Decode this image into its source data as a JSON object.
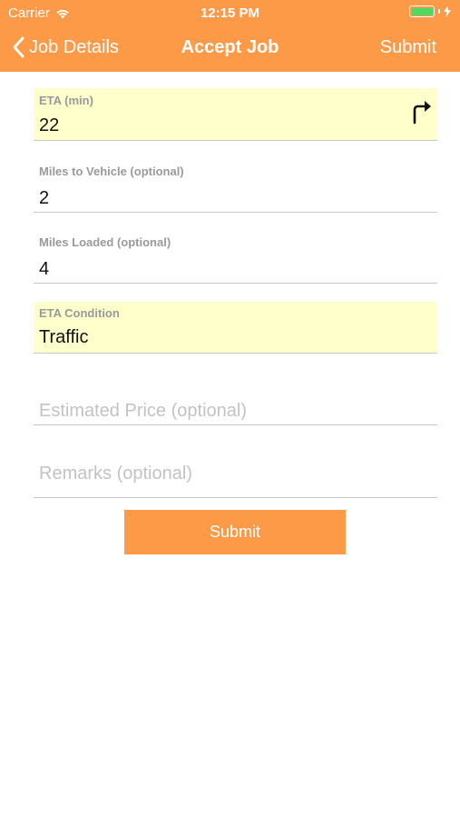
{
  "status_bar": {
    "carrier": "Carrier",
    "time": "12:15 PM",
    "battery_color": "#4cd964"
  },
  "nav": {
    "back_label": "Job Details",
    "title": "Accept Job",
    "submit_label": "Submit"
  },
  "form": {
    "eta": {
      "label": "ETA (min)",
      "value": "22",
      "icon": "turn-right-arrow-icon"
    },
    "miles_to_vehicle": {
      "label": "Miles to Vehicle (optional)",
      "value": "2"
    },
    "miles_loaded": {
      "label": "Miles Loaded (optional)",
      "value": "4"
    },
    "eta_condition": {
      "label": "ETA Condition",
      "value": "Traffic"
    },
    "estimated_price": {
      "placeholder": "Estimated Price (optional)"
    },
    "remarks": {
      "placeholder": "Remarks (optional)"
    },
    "submit_label": "Submit"
  },
  "colors": {
    "accent": "#fc9a48",
    "highlight_field": "#ffffcc"
  }
}
